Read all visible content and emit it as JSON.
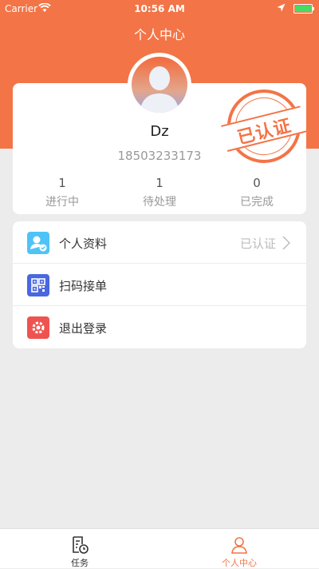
{
  "status_bar": {
    "carrier": "Carrier",
    "time": "10:56 AM"
  },
  "header": {
    "title": "个人中心"
  },
  "profile": {
    "name": "Dz",
    "phone": "18503233173",
    "stamp": "已认证"
  },
  "stats": [
    {
      "value": "1",
      "label": "进行中"
    },
    {
      "value": "1",
      "label": "待处理"
    },
    {
      "value": "0",
      "label": "已完成"
    }
  ],
  "menu": {
    "items": [
      {
        "label": "个人资料",
        "status": "已认证",
        "icon": "profile-icon",
        "color": "#4fc3f7"
      },
      {
        "label": "扫码接单",
        "icon": "qr-code-icon",
        "color": "#4a67e0"
      },
      {
        "label": "退出登录",
        "icon": "logout-icon",
        "color": "#ef5350"
      }
    ]
  },
  "tabs": [
    {
      "label": "任务",
      "icon": "task-icon"
    },
    {
      "label": "个人中心",
      "icon": "user-icon"
    }
  ],
  "colors": {
    "accent": "#f37446",
    "inactive": "#333333"
  }
}
